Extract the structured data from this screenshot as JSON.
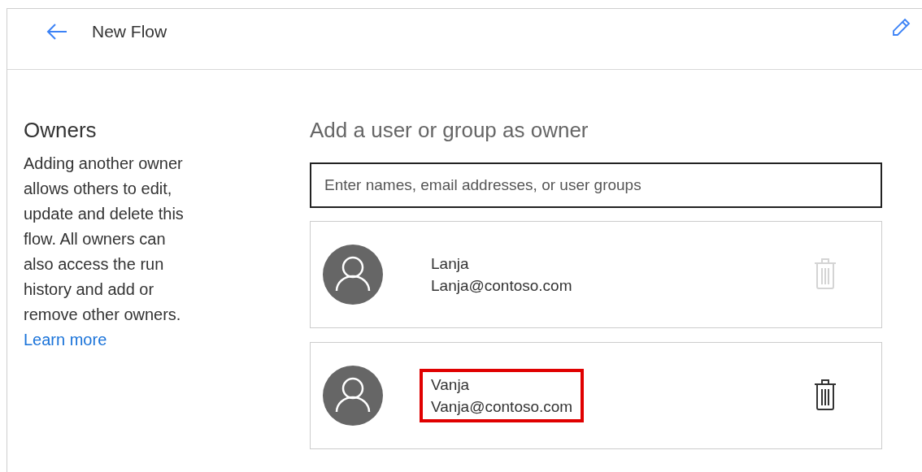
{
  "header": {
    "title": "New Flow"
  },
  "owners_info": {
    "title": "Owners",
    "description": "Adding another owner allows others to edit, update and delete this flow. All owners can also access the run history and add or remove other owners.",
    "link": "Learn more"
  },
  "add_owner": {
    "title": "Add a user or group as owner",
    "search": {
      "placeholder": "Enter names, email addresses, or user groups"
    }
  },
  "owners": [
    {
      "name": "Lanja",
      "email": "Lanja@contoso.com",
      "delete_disabled": true,
      "highlighted": false
    },
    {
      "name": "Vanja",
      "email": "Vanja@contoso.com",
      "delete_disabled": false,
      "highlighted": true
    }
  ]
}
